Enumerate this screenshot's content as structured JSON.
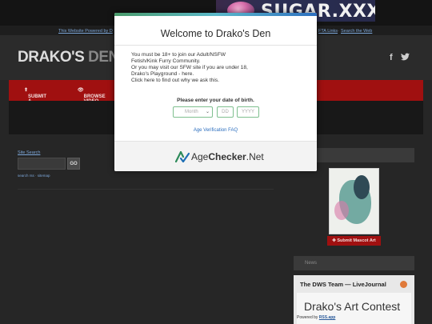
{
  "ad": {
    "text": "SUGAR.XXX"
  },
  "linkbar": {
    "powered": "This Website Powered by D",
    "links": "FTA Links",
    "sep": " · ",
    "search": "Search the Web"
  },
  "header": {
    "logo_part1": "DRAKO'S",
    "logo_part2": "DEN",
    "facebook_icon": "f",
    "twitter_icon": "🐦"
  },
  "nav": {
    "submit_video": "SUBMIT A VIDEO",
    "browse_videos": "BROWSE VIDEO"
  },
  "search": {
    "label": "Site Search",
    "go": "GO",
    "links": "search rss · sitemap"
  },
  "sidebar": {
    "submit_art": "Submit Mascot Art",
    "news_label": "News",
    "lj_title": "The DWS Team — LiveJournal",
    "lj_content": "Drako's Art Contest",
    "powered_by": "Powered by",
    "powered_link": "RSS.app"
  },
  "modal": {
    "title": "Welcome to Drako's Den",
    "message_lines": [
      "You must be 18+ to join our Adult/NSFW",
      "Fetish/Kink Furry Community.",
      "Or you may visit our SFW site if you are under 18,",
      "Drako's Playground - here.",
      "Click here to find out why we ask this."
    ],
    "dob_label": "Please enter your date of birth.",
    "month_placeholder": "Month",
    "day_placeholder": "DD",
    "year_placeholder": "YYYY",
    "faq": "Age Verification FAQ",
    "brand_part1": "Age",
    "brand_part2": "Checker",
    "brand_part3": ".Net"
  }
}
